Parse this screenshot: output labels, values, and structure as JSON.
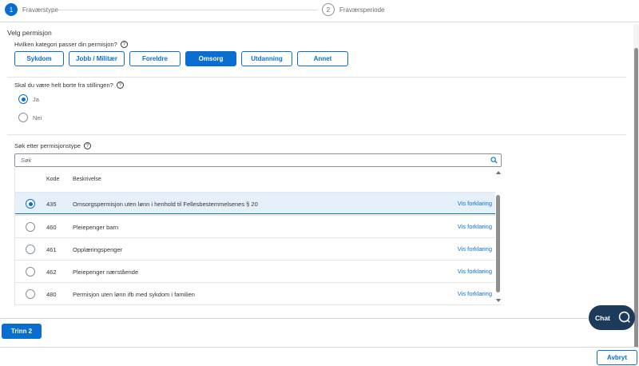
{
  "wizard": {
    "steps": [
      {
        "number": "1",
        "label": "Fraværstype"
      },
      {
        "number": "2",
        "label": "Fraværsperiode"
      }
    ]
  },
  "section": {
    "title": "Velg permisjon"
  },
  "category": {
    "question": "Hvilken kategori passer din permisjon?",
    "options": [
      "Sykdom",
      "Jobb / Militær",
      "Foreldre",
      "Omsorg",
      "Utdanning",
      "Annet"
    ],
    "selected": "Omsorg"
  },
  "absence": {
    "question": "Skal du være helt borte fra stillingen?",
    "options": [
      "Ja",
      "Nei"
    ],
    "selected": "Ja"
  },
  "search": {
    "label": "Søk etter permisjonstype",
    "placeholder": "Søk"
  },
  "table": {
    "headers": [
      "Kode",
      "Beskrivelse"
    ],
    "rows": [
      {
        "code": "435",
        "description": "Omsorgspermisjon uten lønn i henhold til Fellesbestemmelsenes § 20",
        "link": "Vis forklaring",
        "selected": true
      },
      {
        "code": "460",
        "description": "Pleiepenger barn",
        "link": "Vis forklaring",
        "selected": false
      },
      {
        "code": "461",
        "description": "Opplæringspenger",
        "link": "Vis forklaring",
        "selected": false
      },
      {
        "code": "462",
        "description": "Pleiepenger nærstående",
        "link": "Vis forklaring",
        "selected": false
      },
      {
        "code": "480",
        "description": "Permisjon uten lønn ifb med sykdom i familien",
        "link": "Vis forklaring",
        "selected": false
      }
    ]
  },
  "actions": {
    "next": "Trinn 2",
    "chat": "Chat",
    "cancel": "Avbryt"
  },
  "colors": {
    "accent": "#0a6ed1",
    "chat_bg": "#1c3a5a",
    "selected_row": "#e5f0fa"
  }
}
